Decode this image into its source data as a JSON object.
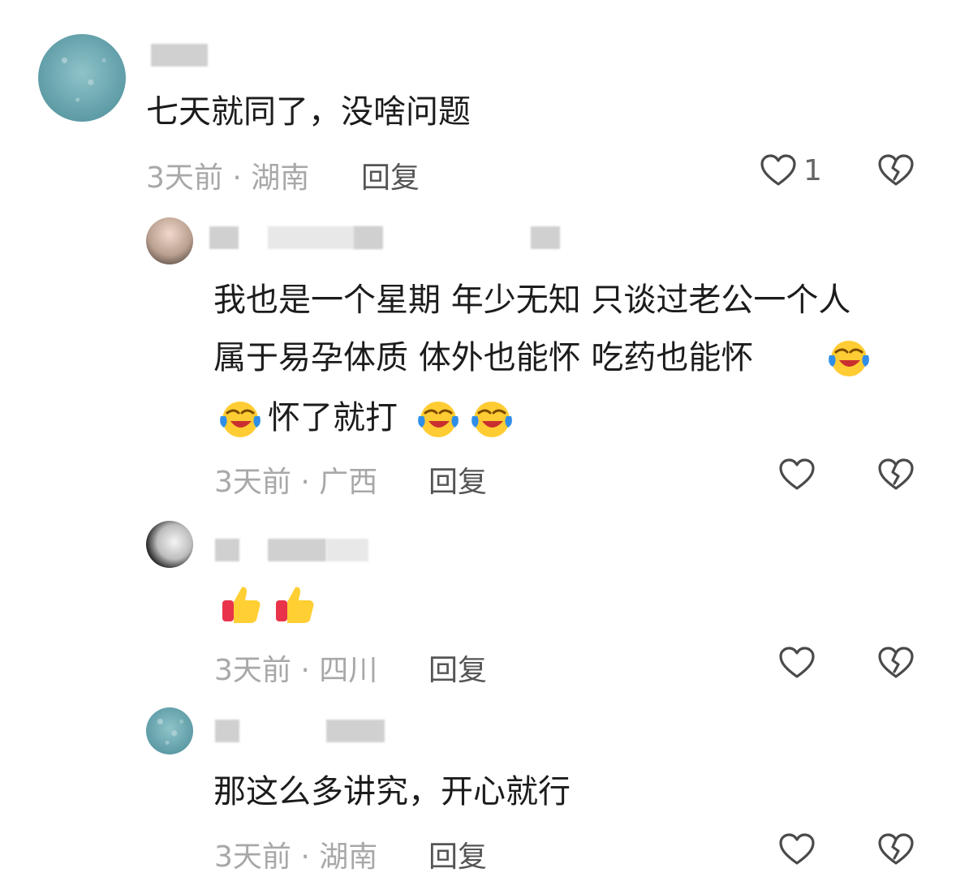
{
  "comments": [
    {
      "text": "七天就同了，没啥问题",
      "meta": "3天前 · 湖南",
      "reply": "回复",
      "likes": "1"
    },
    {
      "line1": "我也是一个星期 年少无知 只谈过老公一个人",
      "line2": "属于易孕体质  体外也能怀 吃药也能怀",
      "line3a": "怀了就打",
      "meta": "3天前 · 广西",
      "reply": "回复"
    },
    {
      "meta": "3天前 · 四川",
      "reply": "回复"
    },
    {
      "text": "那这么多讲究，开心就行",
      "meta": "3天前 · 湖南",
      "reply": "回复"
    }
  ],
  "icons": [
    "heart-outline-icon",
    "broken-heart-icon",
    "crying-laugh-emoji",
    "thumbs-up-emoji"
  ]
}
